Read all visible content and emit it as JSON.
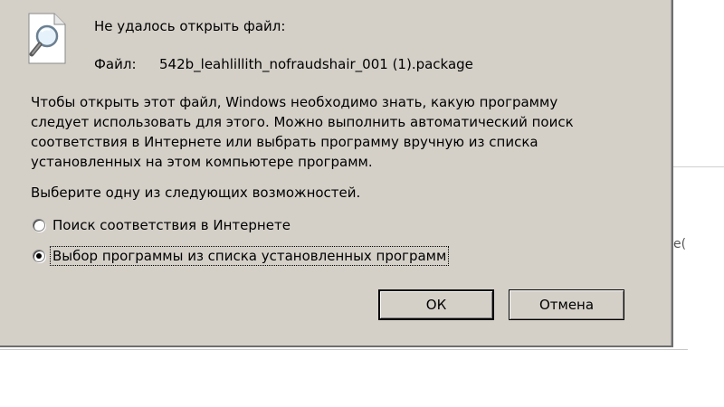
{
  "dialog": {
    "header": "Не удалось открыть файл:",
    "file_label": "Файл:",
    "file_name": "542b_leahlillith_nofraudshair_001 (1).package",
    "body_lines": [
      "Чтобы открыть этот файл, Windows необходимо знать, какую программу",
      "следует использовать для этого. Можно выполнить автоматический поиск",
      "соответствия в Интернете или выбрать программу вручную из списка",
      "установленных на этом компьютере программ."
    ],
    "prompt": "Выберите одну из следующих возможностей.",
    "options": [
      {
        "label": "Поиск соответствия в Интернете",
        "selected": false
      },
      {
        "label": "Выбор программы из списка установленных программ",
        "selected": true
      }
    ],
    "ok_label": "ОК",
    "cancel_label": "Отмена",
    "icon": "file-search-icon"
  },
  "background": {
    "partial_text": "е("
  },
  "colors": {
    "dialog_bg": "#d4d0c8",
    "border_dark": "#808080",
    "border_light": "#ffffff"
  }
}
